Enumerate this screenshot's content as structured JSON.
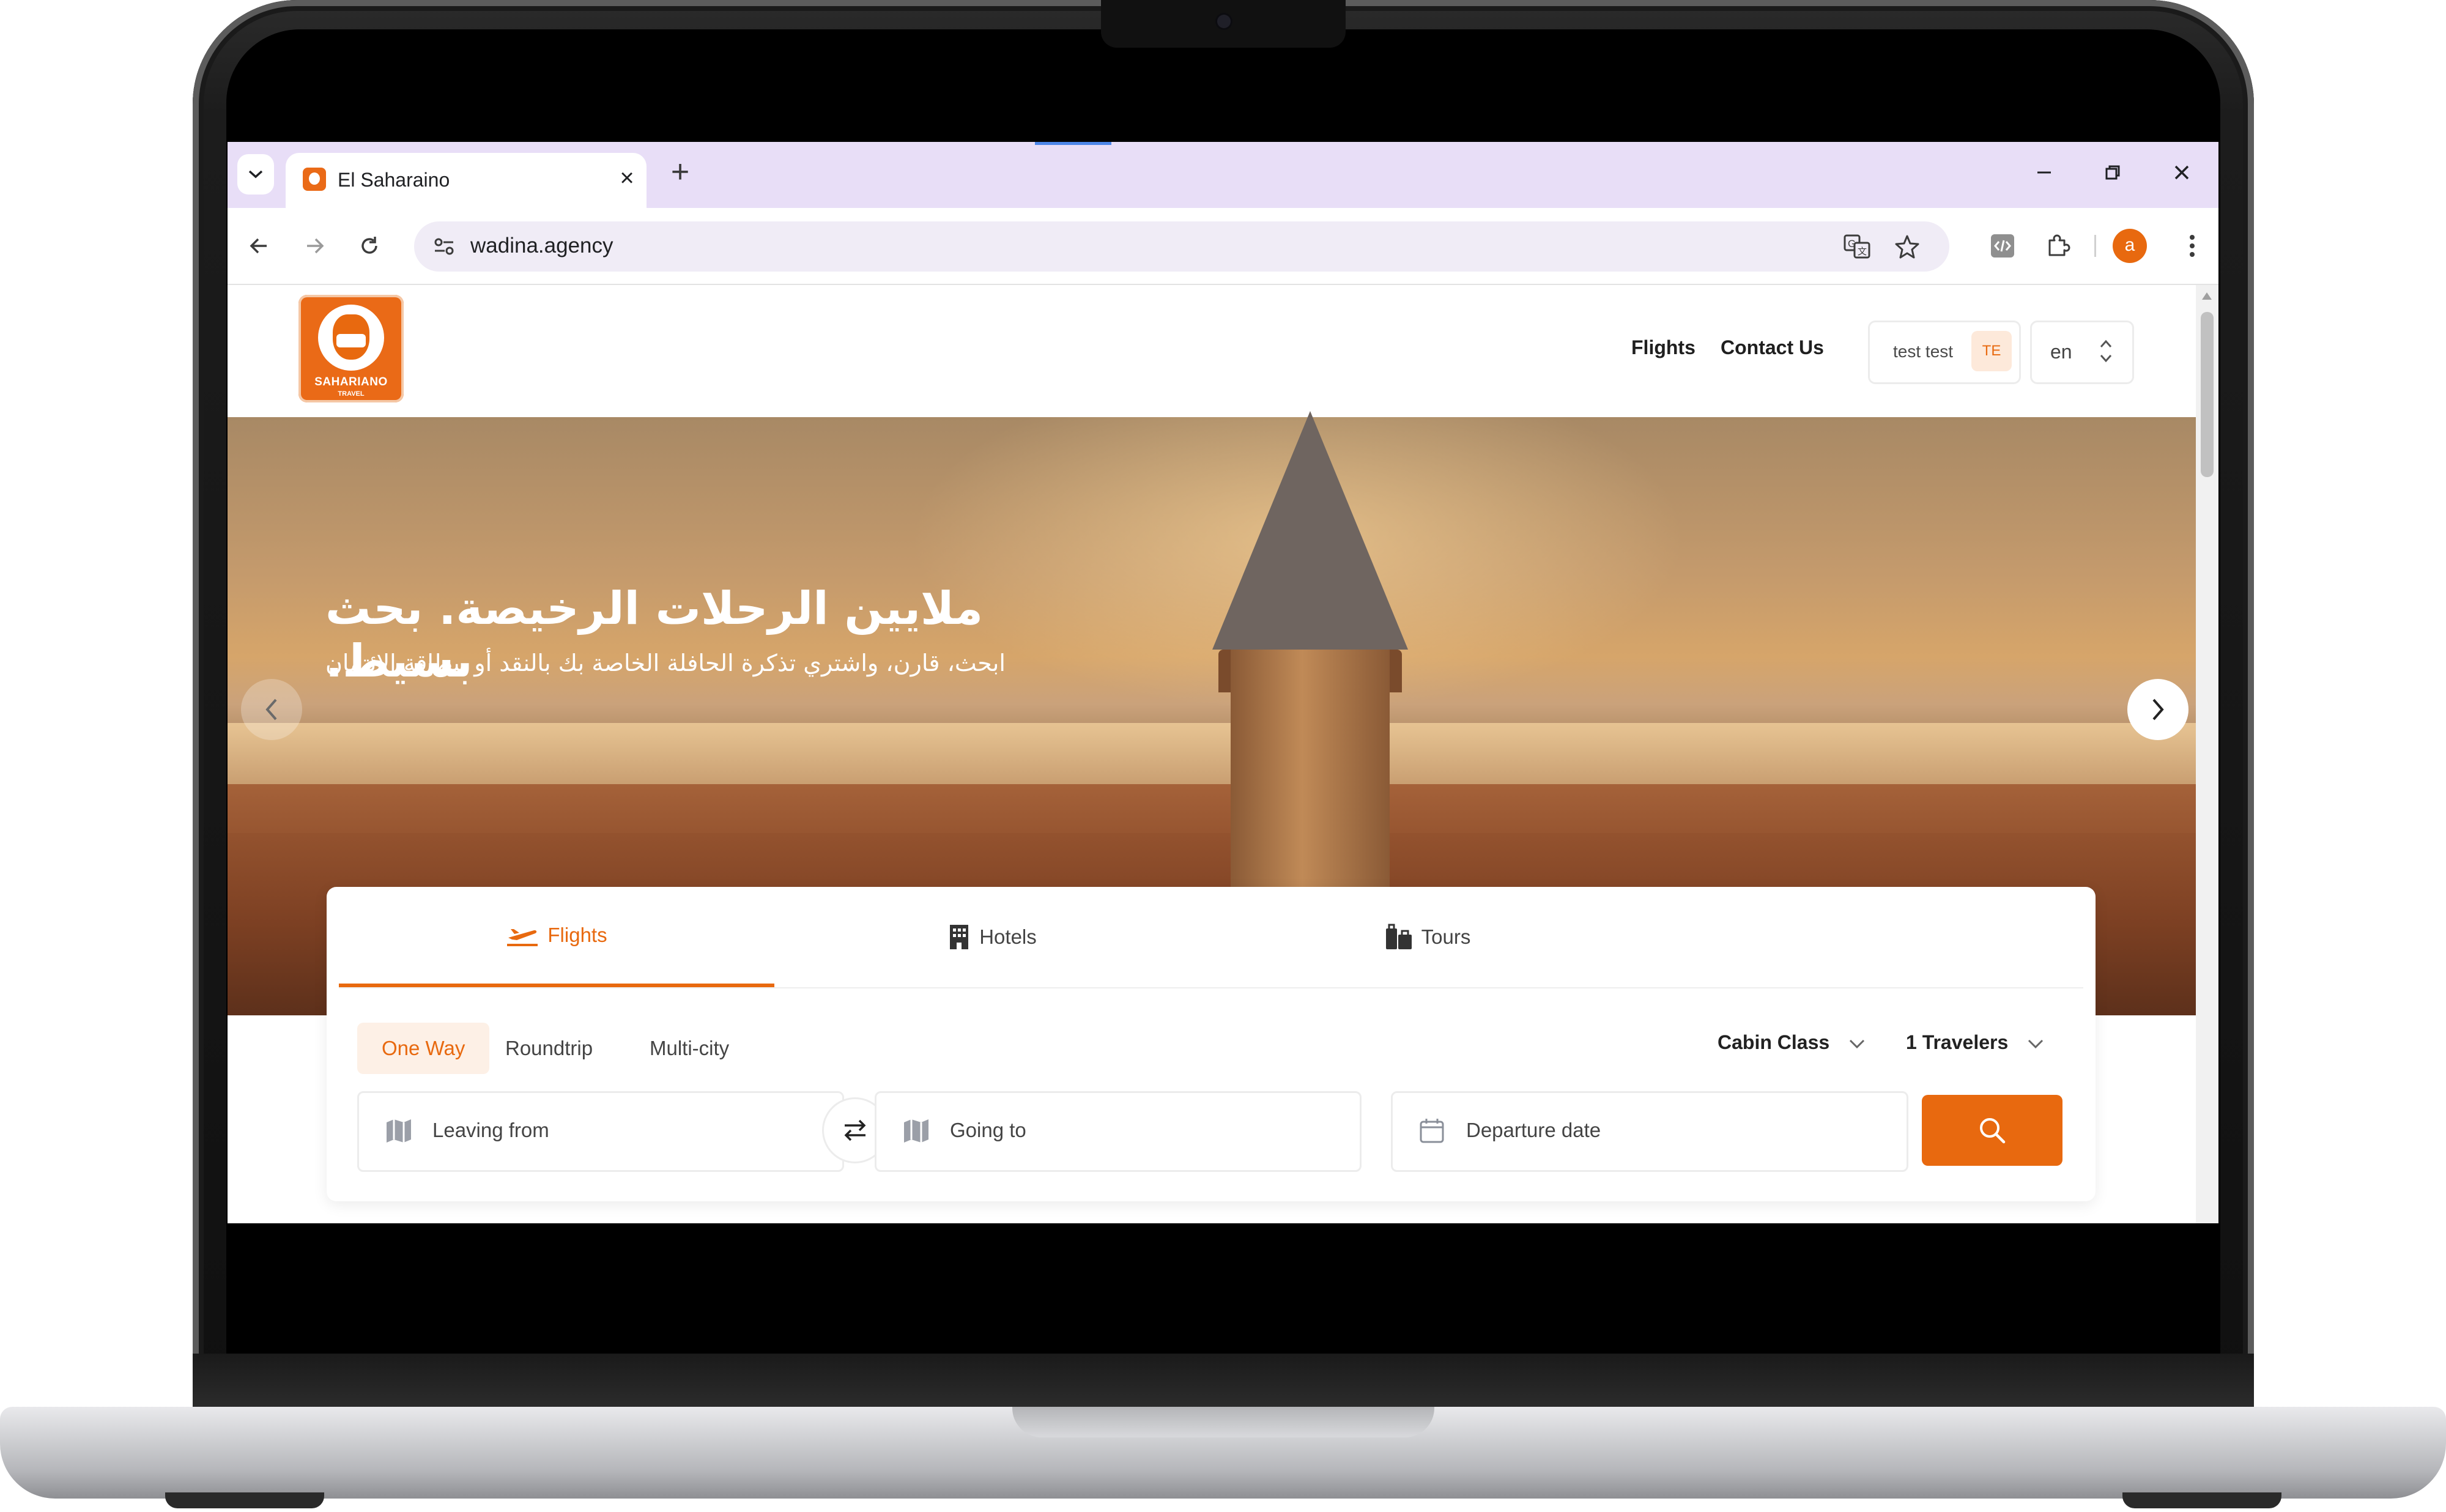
{
  "browser": {
    "tab_title": "El Saharaino",
    "url": "wadina.agency",
    "profile_initial": "a",
    "accent_color": "#e8690f",
    "tabstrip_color": "#e8def7"
  },
  "site": {
    "logo_text": "SAHARIANO",
    "logo_sub": "TRAVEL",
    "nav": {
      "flights": "Flights",
      "contact": "Contact Us"
    },
    "user": {
      "name": "test test",
      "initials": "TE"
    },
    "language": "en"
  },
  "hero": {
    "title": "ملايين الرحلات الرخيصة. بحث بسيط.",
    "subtitle": "ابحث، قارن، واشتري تذكرة الحافلة الخاصة بك بالنقد أو ببطاقة الائتمان"
  },
  "search": {
    "tabs": [
      {
        "label": "Flights",
        "icon": "plane-icon",
        "active": true
      },
      {
        "label": "Hotels",
        "icon": "building-icon",
        "active": false
      },
      {
        "label": "Tours",
        "icon": "luggage-icon",
        "active": false
      }
    ],
    "trip_types": [
      "One Way",
      "Roundtrip",
      "Multi-city"
    ],
    "cabin_class": "Cabin Class",
    "travelers": "1 Travelers",
    "leaving_from": "Leaving from",
    "going_to": "Going to",
    "departure_date": "Departure date"
  }
}
